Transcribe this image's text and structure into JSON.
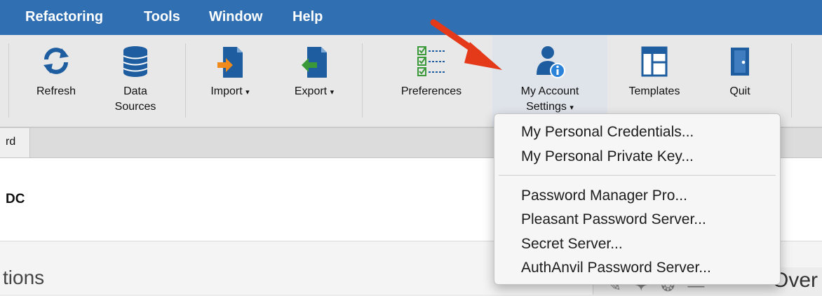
{
  "menubar": {
    "items": [
      "Refactoring",
      "Tools",
      "Window",
      "Help"
    ]
  },
  "toolbar": {
    "refresh": {
      "label": "Refresh"
    },
    "data_sources": {
      "label_line1": "Data",
      "label_line2": "Sources"
    },
    "import": {
      "label": "Import",
      "caret": "▾"
    },
    "export": {
      "label": "Export",
      "caret": "▾"
    },
    "preferences": {
      "label": "Preferences"
    },
    "my_account": {
      "label_line1": "My Account",
      "label_line2": "Settings",
      "caret": "▾"
    },
    "templates": {
      "label": "Templates"
    },
    "quit": {
      "label": "Quit"
    }
  },
  "tabs": {
    "partial_label": "rd"
  },
  "content": {
    "dc_label": "DC",
    "section_title": "tions",
    "right_panel_title": "Over",
    "right_panel_icons": "✎✦❂—"
  },
  "dropdown": {
    "group1": [
      "My Personal Credentials...",
      "My Personal Private Key..."
    ],
    "group2": [
      "Password Manager Pro...",
      "Pleasant Password Server...",
      "Secret Server...",
      "AuthAnvil Password Server..."
    ]
  },
  "colors": {
    "menubar_bg": "#2f6fb2",
    "toolbar_bg": "#e8e8e8",
    "icon_blue": "#1e5d9f",
    "icon_orange": "#f08a1c",
    "icon_green": "#3a9a3a",
    "arrow_red": "#e53a1a"
  },
  "icons": {
    "refresh": "refresh-icon",
    "data_sources": "database-icon",
    "import": "import-icon",
    "export": "export-icon",
    "preferences": "checklist-icon",
    "my_account": "user-info-icon",
    "templates": "template-icon",
    "quit": "door-icon",
    "annotation": "red-arrow-icon"
  }
}
